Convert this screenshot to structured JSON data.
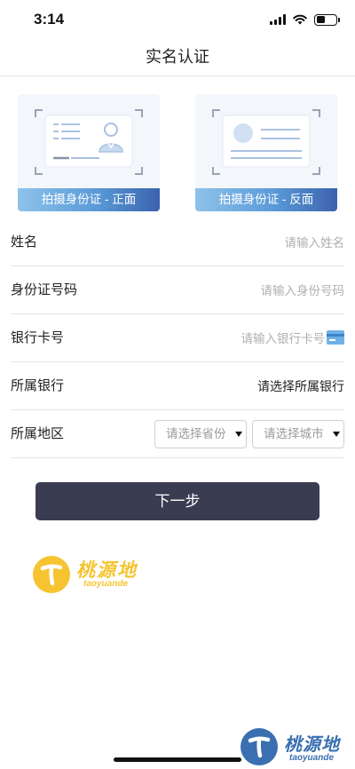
{
  "status_bar": {
    "time": "3:14",
    "battery_level": 0.45
  },
  "nav": {
    "title": "实名认证"
  },
  "id_cards": {
    "front_label": "拍摄身份证 - 正面",
    "back_label": "拍摄身份证 - 反面"
  },
  "form": {
    "name": {
      "label": "姓名",
      "placeholder": "请输入姓名"
    },
    "id_number": {
      "label": "身份证号码",
      "placeholder": "请输入身份号码"
    },
    "bank_card": {
      "label": "银行卡号",
      "placeholder": "请输入银行卡号"
    },
    "bank": {
      "label": "所属银行",
      "value": "请选择所属银行"
    },
    "region": {
      "label": "所属地区",
      "province_placeholder": "请选择省份",
      "city_placeholder": "请选择城市"
    }
  },
  "next_button": {
    "label": "下一步"
  },
  "watermark": {
    "text": "桃源地",
    "subtext": "taoyuande",
    "letter": "T"
  },
  "colors": {
    "button_bg": "#3a3d52",
    "card_label_gradient_start": "#8ec3ea",
    "card_label_gradient_end": "#3c63ad",
    "logo_yellow": "#f6c431",
    "logo_blue": "#3a6fb0"
  },
  "icons": {
    "bank_card": "credit-card-icon",
    "signal": "cellular-signal-icon",
    "wifi": "wifi-icon",
    "battery": "battery-icon"
  }
}
